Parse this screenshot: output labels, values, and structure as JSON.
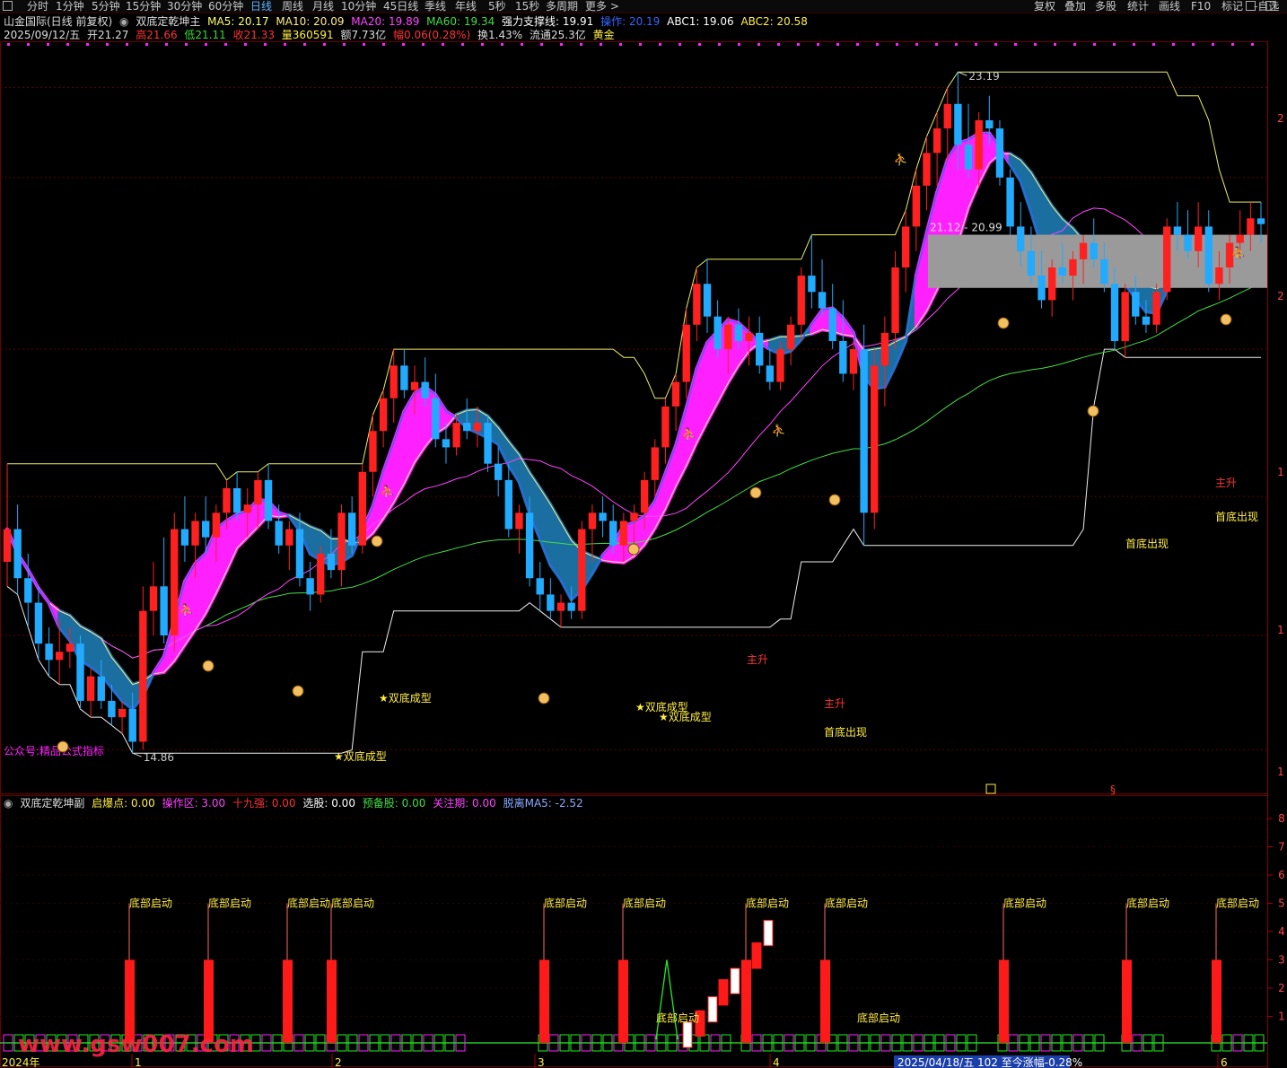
{
  "toolbar": {
    "left_items": [
      "分时",
      "1分钟",
      "5分钟",
      "15分钟",
      "30分钟",
      "60分钟",
      "日线",
      "周线",
      "月线",
      "10分钟",
      "45日线",
      "季线",
      "年线",
      "5秒",
      "15秒",
      "多周期",
      "更多 >"
    ],
    "active": "日线",
    "right_items": [
      "复权",
      "叠加",
      "多股",
      "统计",
      "画线",
      "F10",
      "标记",
      "-自选"
    ]
  },
  "header": {
    "stock": "山金国际(日线 前复权)",
    "indicator": "双底定乾坤主",
    "ma5": "MA5: 20.17",
    "ma10": "MA10: 20.09",
    "ma20": "MA20: 19.89",
    "ma60": "MA60: 19.34",
    "support": "强力支撑线: 19.91",
    "op": "操作: 20.19",
    "abc1": "ABC1: 19.06",
    "abc2": "ABC2: 20.58"
  },
  "quote": {
    "date": "2025/09/12/五",
    "open": "开21.27",
    "high": "高21.66",
    "low": "低21.11",
    "close": "收21.33",
    "vol": "量360591",
    "amount": "额7.73亿",
    "change": "幅0.06(0.28%)",
    "turnover": "换1.43%",
    "float": "流通25.3亿",
    "tag": "黄金"
  },
  "sub_header": {
    "name": "双底定乾坤副",
    "qbd": "启爆点: 0.00",
    "czq": "操作区: 3.00",
    "sjq": "十九强: 0.00",
    "xg": "选股: 0.00",
    "ybg": "预备股: 0.00",
    "gzq": "关注期: 0.00",
    "tl": "脱离MA5: -2.52"
  },
  "annotations": {
    "high_price": "23.19",
    "low_price": "14.86",
    "zone": "21.12 - 20.99",
    "double_bottom": "★双底成型",
    "main_rise": "主升",
    "first_bottom": "首底出现",
    "gzh": "公众号:精品公式指标",
    "bottom_start": "底部启动"
  },
  "right_axis": {
    "main": [
      "2",
      "2",
      "1",
      "1",
      "1"
    ],
    "sub": [
      "8",
      "7",
      "6",
      "5",
      "4",
      "3",
      "2",
      "1"
    ]
  },
  "bottom": {
    "year": "2024年",
    "months": [
      "1",
      "2",
      "3",
      "4",
      "6"
    ],
    "status": "2025/04/18/五 102 至今涨幅-0.28%"
  },
  "watermark": "www.gsw007.com",
  "colors": {
    "up": "#ff2020",
    "down": "#22aaff",
    "ribbon_up": "#ff20ff",
    "ribbon_down": "#1a6fa0",
    "ma5": "#ffff66",
    "ma20": "#ff44ff",
    "ma60": "#44dd44",
    "label_yellow": "#ffee44",
    "label_red": "#ff3333"
  },
  "chart_data": {
    "type": "candlestick",
    "title": "山金国际(日线 前复权)",
    "ylim": [
      14.5,
      23.5
    ],
    "candles": [
      [
        17.2,
        18.4,
        16.9,
        17.6
      ],
      [
        17.6,
        17.9,
        16.8,
        17.0
      ],
      [
        17.0,
        17.3,
        16.4,
        16.7
      ],
      [
        16.7,
        16.9,
        16.0,
        16.2
      ],
      [
        16.2,
        16.4,
        15.8,
        16.0
      ],
      [
        16.0,
        16.5,
        15.7,
        16.1
      ],
      [
        16.1,
        16.4,
        15.9,
        16.2
      ],
      [
        16.2,
        16.3,
        15.4,
        15.5
      ],
      [
        15.5,
        15.9,
        15.3,
        15.8
      ],
      [
        15.8,
        16.0,
        15.4,
        15.5
      ],
      [
        15.5,
        15.7,
        15.2,
        15.3
      ],
      [
        15.3,
        15.5,
        15.1,
        15.4
      ],
      [
        15.4,
        15.6,
        14.86,
        15.0
      ],
      [
        15.0,
        16.9,
        14.9,
        16.6
      ],
      [
        16.6,
        17.2,
        16.3,
        16.9
      ],
      [
        16.9,
        17.5,
        16.2,
        16.3
      ],
      [
        16.3,
        17.8,
        16.1,
        17.6
      ],
      [
        17.6,
        18.0,
        17.2,
        17.4
      ],
      [
        17.4,
        17.8,
        17.0,
        17.7
      ],
      [
        17.7,
        18.0,
        17.3,
        17.5
      ],
      [
        17.5,
        17.9,
        17.2,
        17.8
      ],
      [
        17.8,
        18.2,
        17.6,
        18.1
      ],
      [
        18.1,
        18.3,
        17.7,
        17.8
      ],
      [
        17.8,
        18.1,
        17.5,
        17.9
      ],
      [
        17.9,
        18.3,
        17.6,
        18.2
      ],
      [
        18.2,
        18.4,
        17.6,
        17.7
      ],
      [
        17.7,
        17.9,
        17.3,
        17.4
      ],
      [
        17.4,
        17.7,
        17.1,
        17.6
      ],
      [
        17.6,
        17.8,
        16.9,
        17.0
      ],
      [
        17.0,
        17.2,
        16.6,
        16.8
      ],
      [
        16.8,
        17.4,
        16.7,
        17.3
      ],
      [
        17.3,
        17.6,
        17.0,
        17.1
      ],
      [
        17.1,
        17.9,
        16.9,
        17.8
      ],
      [
        17.8,
        18.0,
        17.3,
        17.4
      ],
      [
        17.4,
        18.4,
        17.3,
        18.3
      ],
      [
        18.3,
        19.0,
        18.0,
        18.8
      ],
      [
        18.8,
        19.3,
        18.6,
        19.2
      ],
      [
        19.2,
        19.8,
        18.9,
        19.6
      ],
      [
        19.6,
        19.8,
        19.2,
        19.3
      ],
      [
        19.3,
        19.6,
        19.0,
        19.4
      ],
      [
        19.4,
        19.7,
        19.1,
        19.2
      ],
      [
        19.2,
        19.5,
        18.6,
        18.7
      ],
      [
        18.7,
        18.9,
        18.4,
        18.6
      ],
      [
        18.6,
        19.0,
        18.5,
        18.9
      ],
      [
        18.9,
        19.2,
        18.7,
        18.8
      ],
      [
        18.8,
        19.1,
        18.6,
        18.9
      ],
      [
        18.9,
        19.0,
        18.3,
        18.4
      ],
      [
        18.4,
        18.6,
        18.0,
        18.2
      ],
      [
        18.2,
        18.4,
        17.5,
        17.6
      ],
      [
        17.6,
        17.9,
        17.3,
        17.8
      ],
      [
        17.8,
        18.0,
        16.9,
        17.0
      ],
      [
        17.0,
        17.2,
        16.6,
        16.8
      ],
      [
        16.8,
        17.0,
        16.5,
        16.6
      ],
      [
        16.6,
        16.8,
        16.4,
        16.7
      ],
      [
        16.7,
        16.9,
        16.5,
        16.6
      ],
      [
        16.6,
        17.7,
        16.5,
        17.6
      ],
      [
        17.6,
        17.9,
        17.2,
        17.8
      ],
      [
        17.8,
        18.0,
        17.5,
        17.7
      ],
      [
        17.7,
        17.9,
        17.3,
        17.4
      ],
      [
        17.4,
        17.8,
        17.2,
        17.7
      ],
      [
        17.7,
        17.9,
        17.4,
        17.8
      ],
      [
        17.8,
        18.3,
        17.6,
        18.2
      ],
      [
        18.2,
        18.7,
        18.0,
        18.6
      ],
      [
        18.6,
        19.2,
        18.4,
        19.1
      ],
      [
        19.1,
        19.5,
        18.8,
        19.4
      ],
      [
        19.4,
        20.3,
        19.2,
        20.1
      ],
      [
        20.1,
        20.8,
        19.9,
        20.6
      ],
      [
        20.6,
        20.9,
        20.0,
        20.2
      ],
      [
        20.2,
        20.4,
        19.7,
        19.8
      ],
      [
        19.8,
        20.2,
        19.5,
        20.1
      ],
      [
        20.1,
        20.3,
        19.8,
        19.9
      ],
      [
        19.9,
        20.2,
        19.6,
        20.0
      ],
      [
        20.0,
        20.2,
        19.5,
        19.6
      ],
      [
        19.6,
        19.8,
        19.3,
        19.4
      ],
      [
        19.4,
        19.9,
        19.3,
        19.8
      ],
      [
        19.8,
        20.2,
        19.6,
        20.1
      ],
      [
        20.1,
        20.8,
        19.9,
        20.7
      ],
      [
        20.7,
        21.2,
        20.3,
        20.5
      ],
      [
        20.5,
        20.9,
        20.2,
        20.3
      ],
      [
        20.3,
        20.6,
        19.8,
        19.9
      ],
      [
        19.9,
        20.4,
        19.4,
        19.5
      ],
      [
        19.5,
        19.9,
        19.3,
        19.8
      ],
      [
        19.8,
        20.1,
        17.4,
        17.8
      ],
      [
        17.8,
        19.8,
        17.6,
        19.6
      ],
      [
        19.6,
        20.2,
        19.1,
        20.0
      ],
      [
        20.0,
        21.0,
        19.8,
        20.8
      ],
      [
        20.8,
        21.5,
        20.5,
        21.3
      ],
      [
        21.3,
        22.0,
        21.0,
        21.8
      ],
      [
        21.8,
        22.4,
        21.5,
        22.2
      ],
      [
        22.2,
        22.7,
        21.8,
        22.5
      ],
      [
        22.5,
        23.0,
        22.1,
        22.8
      ],
      [
        22.8,
        23.19,
        22.0,
        22.3
      ],
      [
        22.3,
        22.8,
        21.9,
        22.0
      ],
      [
        22.0,
        22.7,
        21.8,
        22.6
      ],
      [
        22.6,
        22.9,
        22.3,
        22.5
      ],
      [
        22.5,
        22.6,
        21.8,
        21.9
      ],
      [
        21.9,
        22.0,
        21.2,
        21.3
      ],
      [
        21.3,
        21.6,
        20.8,
        21.0
      ],
      [
        21.0,
        21.3,
        20.6,
        20.7
      ],
      [
        20.7,
        21.0,
        20.3,
        20.4
      ],
      [
        20.4,
        20.9,
        20.2,
        20.8
      ],
      [
        20.8,
        21.1,
        20.6,
        20.7
      ],
      [
        20.7,
        21.0,
        20.4,
        20.9
      ],
      [
        20.9,
        21.2,
        20.6,
        21.1
      ],
      [
        21.1,
        21.4,
        20.8,
        20.9
      ],
      [
        20.9,
        21.1,
        20.5,
        20.6
      ],
      [
        20.6,
        20.8,
        19.8,
        19.9
      ],
      [
        19.9,
        20.6,
        19.7,
        20.5
      ],
      [
        20.5,
        20.7,
        20.1,
        20.2
      ],
      [
        20.2,
        20.4,
        20.0,
        20.1
      ],
      [
        20.1,
        20.6,
        20.0,
        20.5
      ],
      [
        20.5,
        21.4,
        20.4,
        21.3
      ],
      [
        21.3,
        21.6,
        21.0,
        21.2
      ],
      [
        21.2,
        21.5,
        20.9,
        21.0
      ],
      [
        21.0,
        21.6,
        20.8,
        21.3
      ],
      [
        21.3,
        21.5,
        20.5,
        20.6
      ],
      [
        20.6,
        21.0,
        20.4,
        20.8
      ],
      [
        20.8,
        21.2,
        20.6,
        21.1
      ],
      [
        21.1,
        21.5,
        20.9,
        21.2
      ],
      [
        21.2,
        21.6,
        21.0,
        21.4
      ],
      [
        21.4,
        21.6,
        21.1,
        21.33
      ]
    ]
  }
}
